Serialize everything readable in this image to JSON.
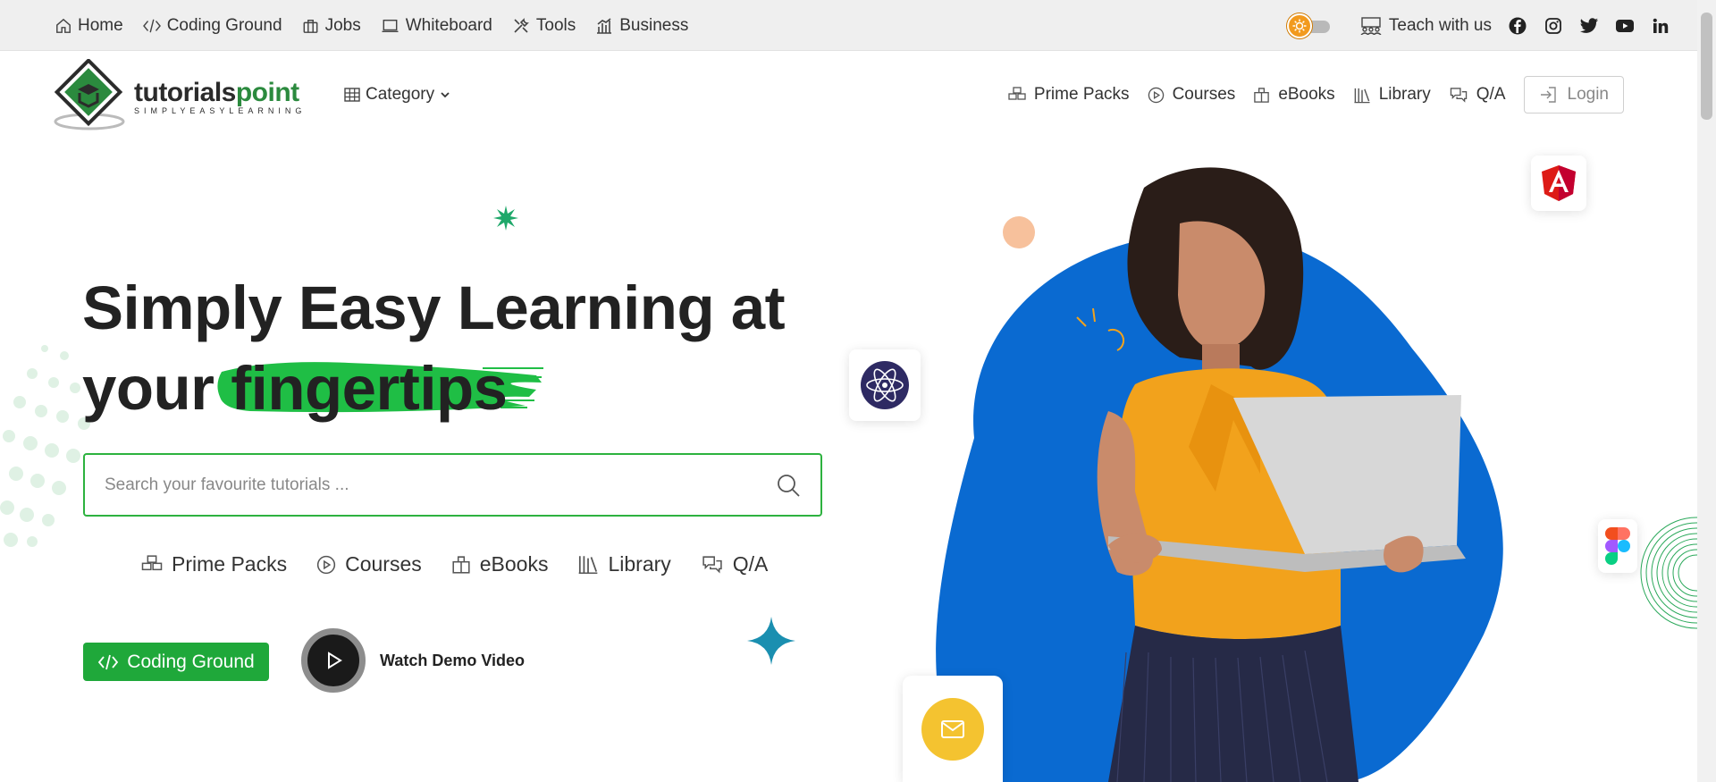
{
  "topbar": {
    "items": [
      {
        "label": "Home",
        "icon": "home-icon"
      },
      {
        "label": "Coding Ground",
        "icon": "code-icon"
      },
      {
        "label": "Jobs",
        "icon": "briefcase-icon"
      },
      {
        "label": "Whiteboard",
        "icon": "whiteboard-icon"
      },
      {
        "label": "Tools",
        "icon": "tools-icon"
      },
      {
        "label": "Business",
        "icon": "chart-icon"
      }
    ],
    "teach_label": "Teach with us"
  },
  "header": {
    "logo_main_a": "tutorials",
    "logo_main_b": "point",
    "logo_sub": "SIMPLYEASYLEARNING",
    "category_label": "Category",
    "nav": [
      {
        "label": "Prime Packs"
      },
      {
        "label": "Courses"
      },
      {
        "label": "eBooks"
      },
      {
        "label": "Library"
      },
      {
        "label": "Q/A"
      }
    ],
    "login_label": "Login"
  },
  "hero": {
    "title_line1": "Simply Easy Learning at",
    "title_line2_a": "your",
    "title_line2_b": "fingertips",
    "search_placeholder": "Search your favourite tutorials ...",
    "subnav": [
      {
        "label": "Prime Packs"
      },
      {
        "label": "Courses"
      },
      {
        "label": "eBooks"
      },
      {
        "label": "Library"
      },
      {
        "label": "Q/A"
      }
    ],
    "coding_ground_label": "Coding Ground",
    "demo_label": "Watch Demo Video"
  },
  "colors": {
    "accent_green": "#1fa83a",
    "blob_blue": "#0a6ad1",
    "shirt": "#f2a21c"
  }
}
